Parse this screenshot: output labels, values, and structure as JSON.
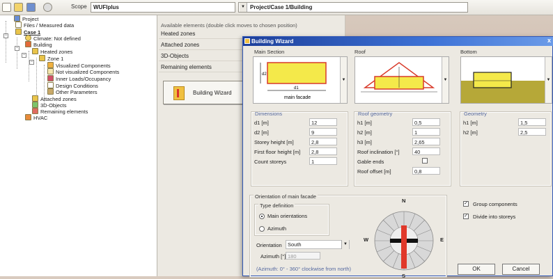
{
  "toolbar": {
    "scope_label": "Scope",
    "scope_value": "WUFIplus",
    "path_value": "Project/Case 1/Building"
  },
  "tree": {
    "items": [
      {
        "label": "Project"
      },
      {
        "label": "Files / Measured data"
      },
      {
        "label": "Case 1"
      },
      {
        "label": "Climate: Not defined"
      },
      {
        "label": "Building"
      },
      {
        "label": "Heated zones"
      },
      {
        "label": "Zone 1"
      },
      {
        "label": "Visualized Components"
      },
      {
        "label": "Not visualized Components"
      },
      {
        "label": "Inner Loads/Occupancy"
      },
      {
        "label": "Design Conditions"
      },
      {
        "label": "Other Parameters"
      },
      {
        "label": "Attached zones"
      },
      {
        "label": "3D-Objects"
      },
      {
        "label": "Remaining elements"
      },
      {
        "label": "HVAC"
      }
    ]
  },
  "elements": {
    "caption": "Available elements (double click moves to chosen position)",
    "rows": [
      "Heated zones",
      "Attached zones",
      "3D-Objects",
      "Remaining elements"
    ],
    "wizard_button": "Building Wizard"
  },
  "dialog": {
    "title": "Building Wizard",
    "close": "x",
    "main_section": {
      "label": "Main Section",
      "preview_caption": "main facade",
      "d1": "d1",
      "d2": "d2"
    },
    "roof_label": "Roof",
    "bottom_label": "Bottom",
    "dimensions": {
      "title": "Dimensions",
      "rows": [
        {
          "label": "d1  [m]",
          "value": "12"
        },
        {
          "label": "d2  [m]",
          "value": "9"
        },
        {
          "label": "Storey height  [m]",
          "value": "2,8"
        },
        {
          "label": "First floor height  [m]",
          "value": "2,8"
        },
        {
          "label": "Count storeys",
          "value": "1"
        }
      ]
    },
    "roof_geometry": {
      "title": "Roof geometry",
      "rows": [
        {
          "label": "h1  [m]",
          "value": "0,5"
        },
        {
          "label": "h2  [m]",
          "value": "1"
        },
        {
          "label": "h3  [m]",
          "value": "2,65"
        },
        {
          "label": "Roof inclination  [°]",
          "value": "40"
        },
        {
          "label": "Gable ends",
          "value": ""
        },
        {
          "label": "Roof offset  [m]",
          "value": "0,8"
        }
      ]
    },
    "geometry": {
      "title": "Geometry",
      "rows": [
        {
          "label": "h1  [m]",
          "value": "1,5"
        },
        {
          "label": "h2  [m]",
          "value": "2,5"
        }
      ]
    },
    "orientation": {
      "title": "Orientation of main facade",
      "type_title": "Type definition",
      "radio_main": "Main orientations",
      "radio_azimuth": "Azimuth",
      "orientation_label": "Orientation",
      "orientation_value": "South",
      "azimuth_label": "Azimuth [°]",
      "azimuth_value": "180",
      "hint": "(Azimuth: 0° - 360° clockwise from north)",
      "compass": {
        "n": "N",
        "s": "S",
        "e": "E",
        "w": "W"
      }
    },
    "options": {
      "group_components": "Group components",
      "divide_storeys": "Divide into storeys"
    },
    "ok": "OK",
    "cancel": "Cancel"
  }
}
